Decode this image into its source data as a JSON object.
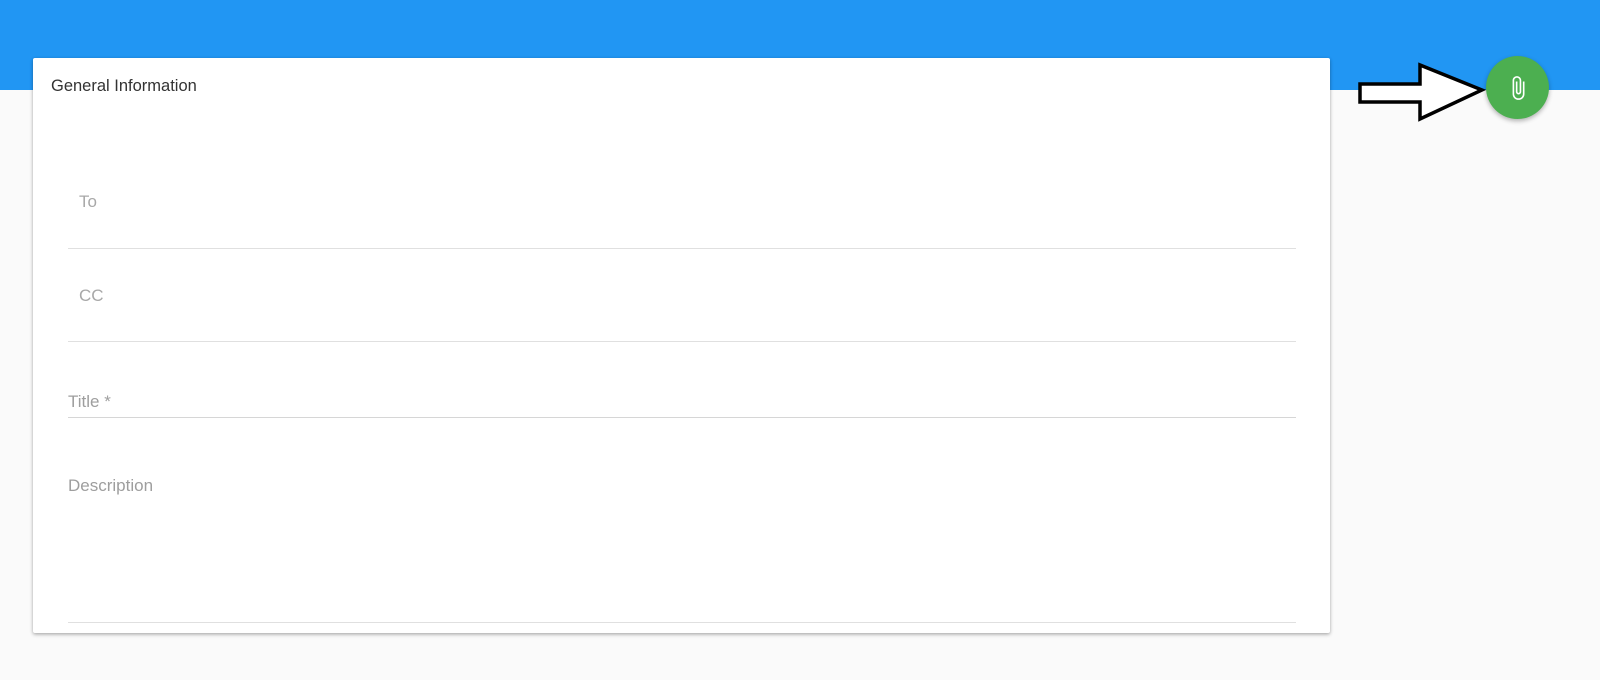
{
  "form": {
    "section_title": "General Information",
    "to": {
      "placeholder": "To",
      "value": ""
    },
    "cc": {
      "placeholder": "CC",
      "value": ""
    },
    "title": {
      "label": "Title *",
      "value": ""
    },
    "description": {
      "label": "Description",
      "value": ""
    }
  },
  "fab": {
    "icon": "paperclip-icon",
    "color": "#4caf50"
  },
  "theme": {
    "header_color": "#2196f3",
    "background": "#fafafa"
  }
}
